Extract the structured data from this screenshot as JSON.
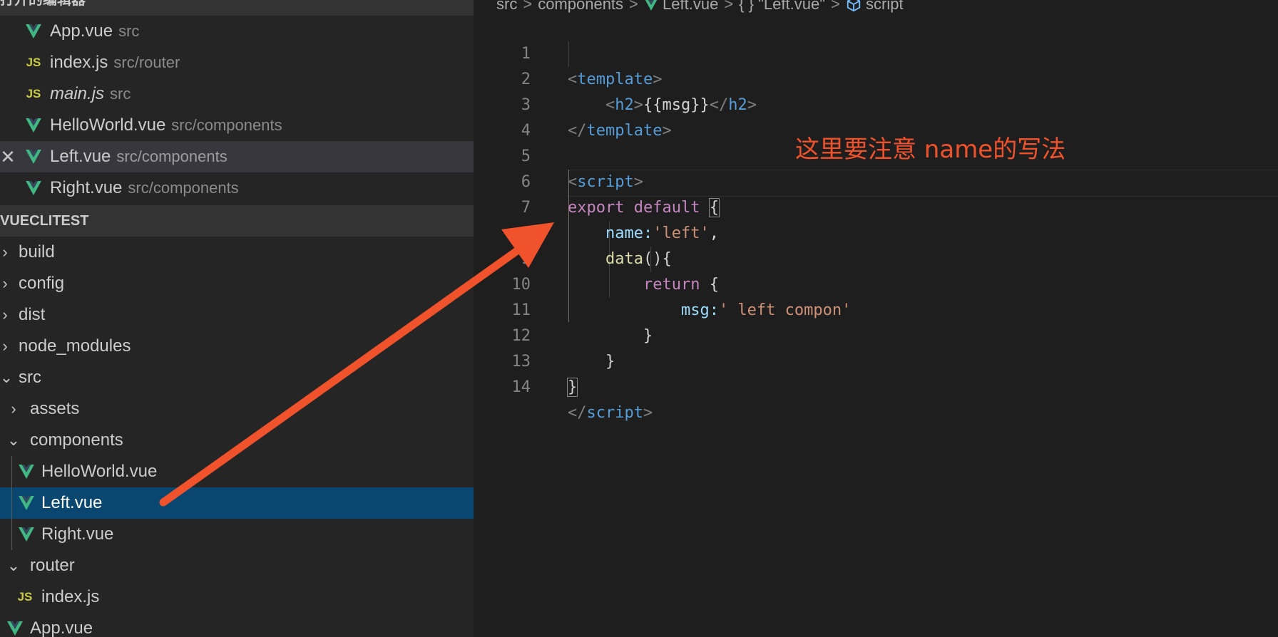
{
  "open_editors": {
    "header": "打开的编辑器",
    "items": [
      {
        "name": "App.vue",
        "path": "src"
      },
      {
        "name": "index.js",
        "path": "src/router"
      },
      {
        "name": "main.js",
        "path": "src"
      },
      {
        "name": "HelloWorld.vue",
        "path": "src/components"
      },
      {
        "name": "Left.vue",
        "path": "src/components"
      },
      {
        "name": "Right.vue",
        "path": "src/components"
      }
    ]
  },
  "explorer": {
    "header": "VUECLITEST",
    "items": [
      {
        "name": "build"
      },
      {
        "name": "config"
      },
      {
        "name": "dist"
      },
      {
        "name": "node_modules"
      },
      {
        "name": "src"
      },
      {
        "name": "assets"
      },
      {
        "name": "components"
      },
      {
        "name": "HelloWorld.vue"
      },
      {
        "name": "Left.vue"
      },
      {
        "name": "Right.vue"
      },
      {
        "name": "router"
      },
      {
        "name": "index.js"
      },
      {
        "name": "App.vue"
      }
    ]
  },
  "breadcrumb": {
    "items": [
      "src",
      "components",
      "Left.vue",
      "\"Left.vue\"",
      "script"
    ],
    "object_glyph": "{ }"
  },
  "icons": {
    "js_label": "JS",
    "vue_color": "#41b883",
    "js_color": "#cbcb41"
  },
  "editor": {
    "line_numbers": [
      "1",
      "2",
      "3",
      "4",
      "5",
      "6",
      "7",
      "8",
      "9",
      "10",
      "11",
      "12",
      "13",
      "14"
    ],
    "tokens": {
      "template": "template",
      "h2": "h2",
      "msg_expr": "{{msg}}",
      "script": "script",
      "export": "export",
      "default": "default",
      "brace_open": "{",
      "name_key": "name:",
      "name_value": "'left'",
      "comma": ",",
      "data_fn": "data",
      "parens_brace": "(){",
      "return": "return",
      "msg_key": "msg:",
      "msg_value": "' left compon'",
      "brace_close": "}"
    }
  },
  "annotation": {
    "text": "这里要注意 name的写法",
    "color": "#f0522b"
  }
}
